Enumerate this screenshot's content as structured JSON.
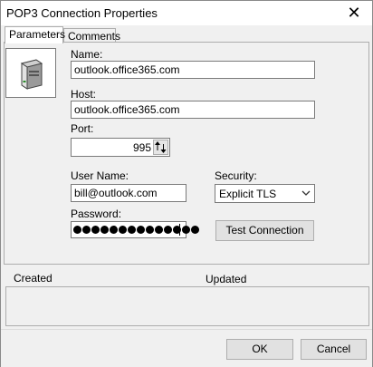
{
  "window": {
    "title": "POP3 Connection Properties",
    "close_glyph": "✕"
  },
  "tabs": [
    {
      "label": "Parameters",
      "active": true
    },
    {
      "label": "Comments",
      "active": false
    }
  ],
  "icon": "server-tower-icon",
  "form": {
    "name": {
      "label": "Name:",
      "value": "outlook.office365.com"
    },
    "host": {
      "label": "Host:",
      "value": "outlook.office365.com"
    },
    "port": {
      "label": "Port:",
      "value": "995"
    },
    "user_name": {
      "label": "User Name:",
      "value": "bill@outlook.com"
    },
    "security": {
      "label": "Security:",
      "value": "Explicit TLS"
    },
    "password": {
      "label": "Password:",
      "masked_length": 14
    },
    "test_connection_label": "Test Connection"
  },
  "info": {
    "created_label": "Created",
    "updated_label": "Updated"
  },
  "footer": {
    "ok_label": "OK",
    "cancel_label": "Cancel"
  }
}
